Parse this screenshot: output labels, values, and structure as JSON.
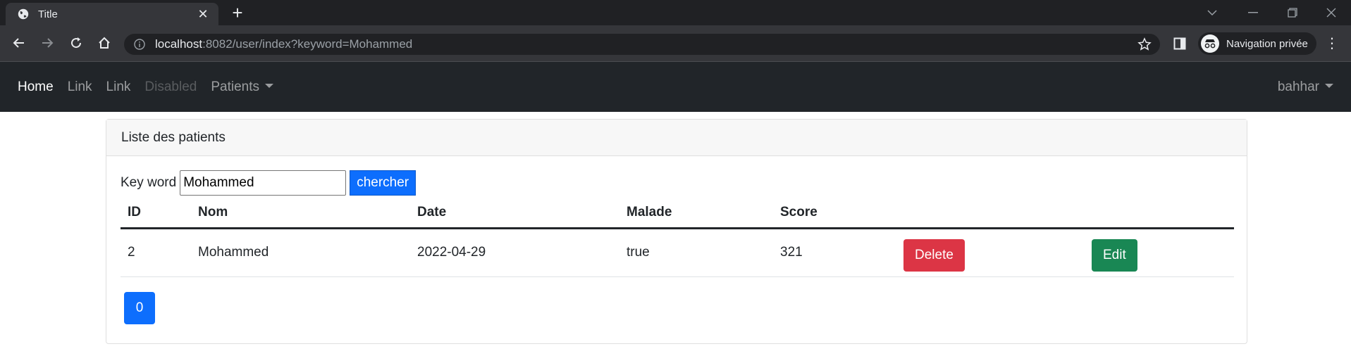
{
  "browser": {
    "tab_title": "Title",
    "tab_close": "✕",
    "new_tab": "+",
    "url_host": "localhost",
    "url_rest": ":8082/user/index?keyword=Mohammed",
    "incognito_label": "Navigation privée",
    "menu": "⋮"
  },
  "navbar": {
    "items": [
      {
        "label": "Home",
        "state": "active"
      },
      {
        "label": "Link",
        "state": "normal"
      },
      {
        "label": "Link",
        "state": "normal"
      },
      {
        "label": "Disabled",
        "state": "disabled"
      },
      {
        "label": "Patients",
        "state": "dropdown"
      }
    ],
    "user": "bahhar"
  },
  "card": {
    "header": "Liste des patients",
    "search": {
      "label": "Key word",
      "value": "Mohammed",
      "button": "chercher"
    },
    "table": {
      "columns": [
        "ID",
        "Nom",
        "Date",
        "Malade",
        "Score"
      ],
      "rows": [
        {
          "id": "2",
          "nom": "Mohammed",
          "date": "2022-04-29",
          "malade": "true",
          "score": "321",
          "delete": "Delete",
          "edit": "Edit"
        }
      ]
    },
    "pagination": [
      "0"
    ]
  },
  "colors": {
    "navbar_bg": "#212529",
    "primary": "#0d6efd",
    "danger": "#dc3545",
    "success": "#198754"
  }
}
